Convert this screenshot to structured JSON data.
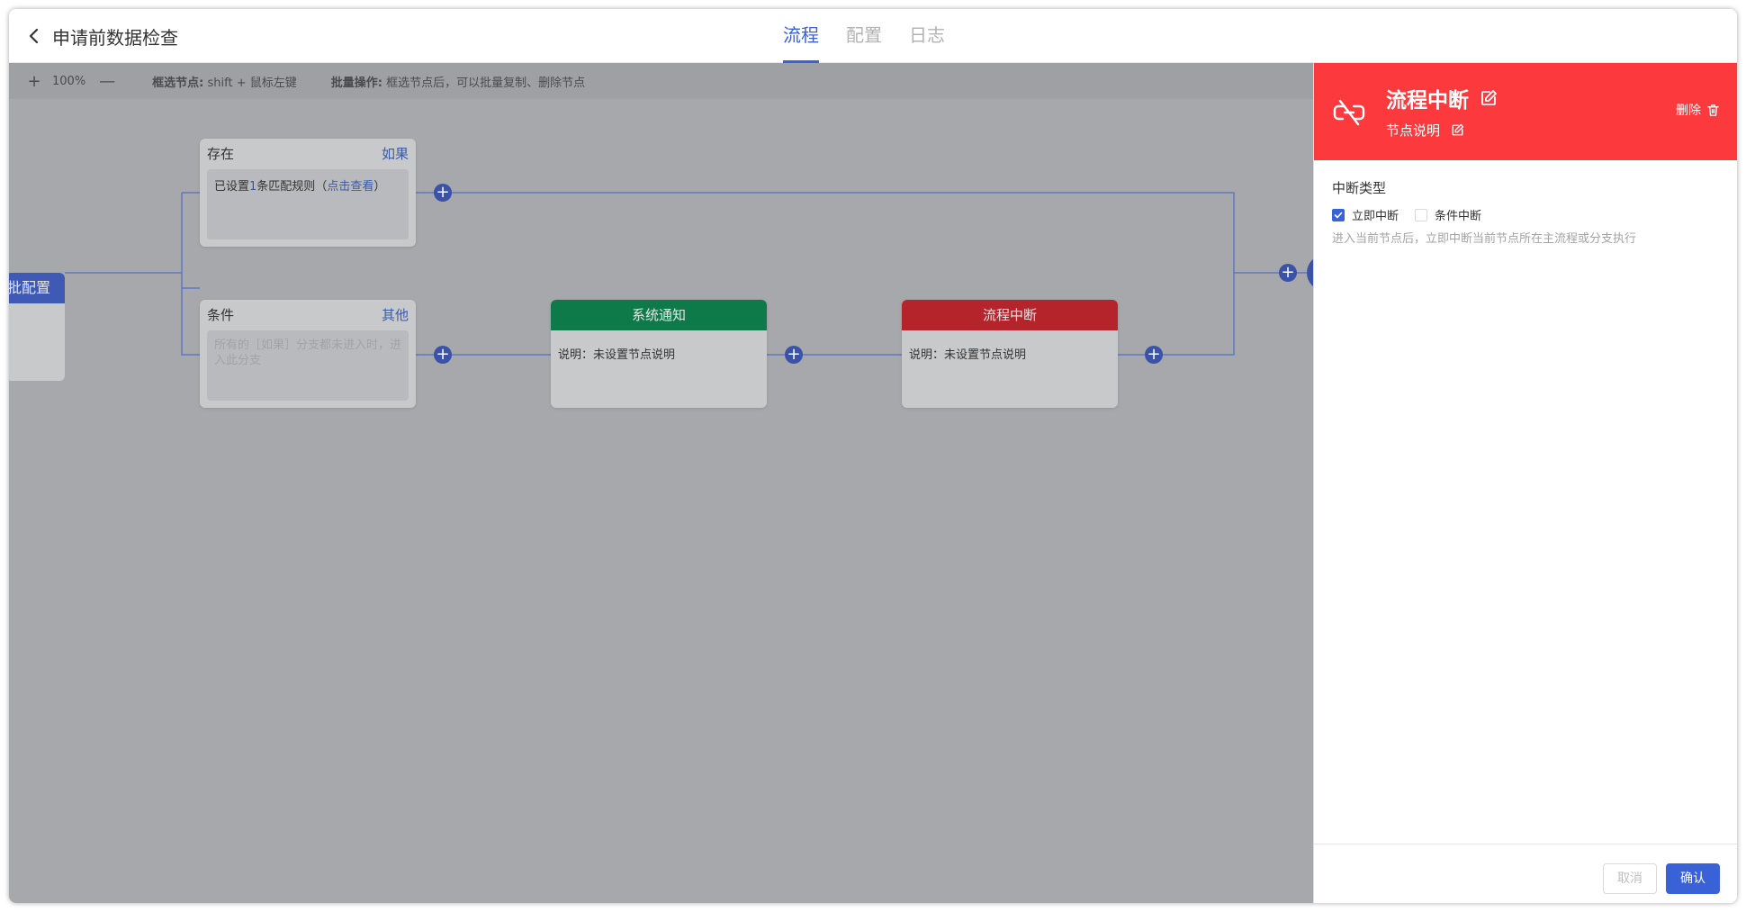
{
  "header": {
    "page_title": "申请前数据检查",
    "tabs": [
      {
        "label": "流程",
        "active": true
      },
      {
        "label": "配置",
        "active": false
      },
      {
        "label": "日志",
        "active": false
      }
    ]
  },
  "toolbar": {
    "zoom": "100%",
    "select_label": "框选节点:",
    "select_hint": "shift + 鼠标左键",
    "batch_label": "批量操作:",
    "batch_hint": "框选节点后，可以批量复制、删除节点"
  },
  "canvas": {
    "approval_node_title": "批配置",
    "condition_exists": {
      "title": "存在",
      "tag": "如果",
      "rule_prefix": "已设置",
      "rule_count": "1",
      "rule_suffix": "条匹配规则（",
      "rule_link": "点击查看",
      "rule_close": "）"
    },
    "condition_else": {
      "title": "条件",
      "tag": "其他",
      "placeholder": "所有的［如果］分支都未进入时，进入此分支"
    },
    "system_notify": {
      "title": "系统通知",
      "desc": "说明：未设置节点说明"
    },
    "flow_break": {
      "title": "流程中断",
      "desc": "说明：未设置节点说明"
    }
  },
  "panel": {
    "title": "流程中断",
    "subtitle": "节点说明",
    "delete_label": "删除",
    "field_label": "中断类型",
    "options": [
      {
        "label": "立即中断",
        "checked": true
      },
      {
        "label": "条件中断",
        "checked": false
      }
    ],
    "hint": "进入当前节点后，立即中断当前节点所在主流程或分支执行",
    "cancel_label": "取消",
    "confirm_label": "确认"
  },
  "colors": {
    "accent": "#3a62d7",
    "panel_header": "#fc393d",
    "notify_node": "#0e7a4a",
    "break_node": "#b5242a",
    "approval_node": "#3f5ab5"
  }
}
